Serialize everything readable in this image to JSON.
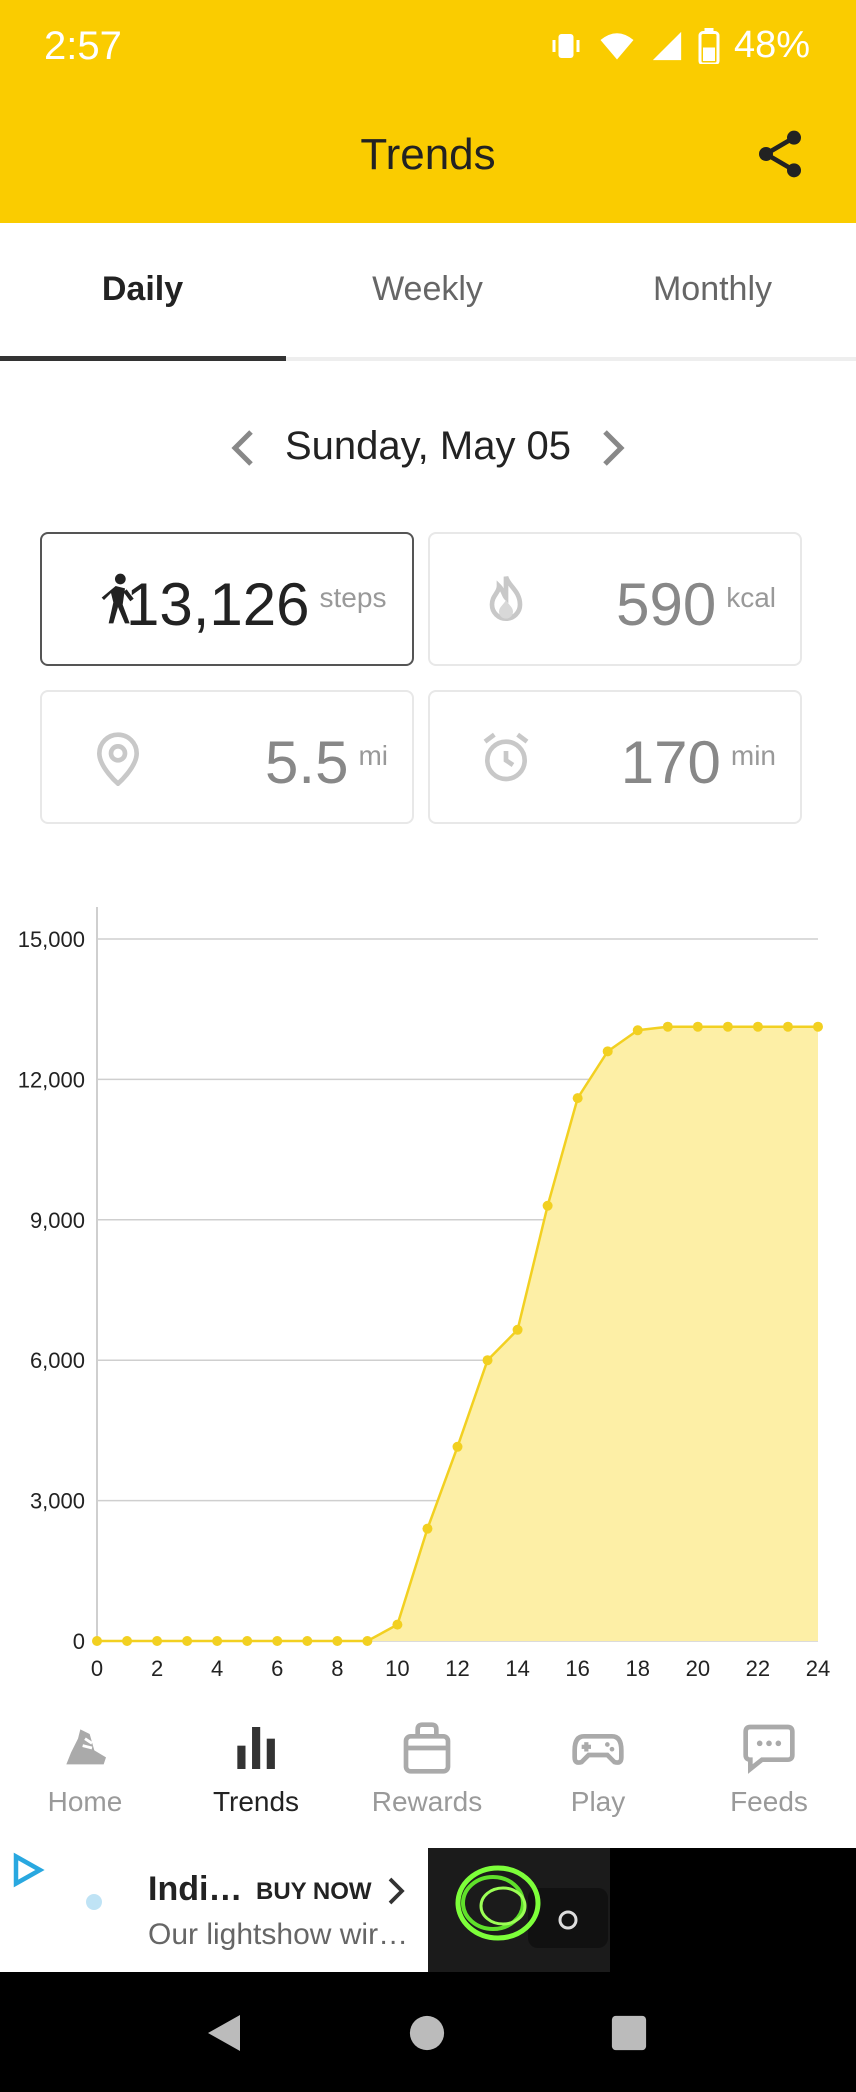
{
  "status_bar": {
    "time": "2:57",
    "battery": "48%"
  },
  "header": {
    "title": "Trends"
  },
  "tabs": [
    {
      "label": "Daily",
      "active": true
    },
    {
      "label": "Weekly",
      "active": false
    },
    {
      "label": "Monthly",
      "active": false
    }
  ],
  "date_nav": {
    "label": "Sunday, May 05"
  },
  "stats": {
    "steps": {
      "value": "13,126",
      "unit": "steps"
    },
    "calories": {
      "value": "590",
      "unit": "kcal"
    },
    "distance": {
      "value": "5.5",
      "unit": "mi"
    },
    "active_time": {
      "value": "170",
      "unit": "min"
    }
  },
  "chart_data": {
    "type": "area",
    "x": [
      0,
      1,
      2,
      3,
      4,
      5,
      6,
      7,
      8,
      9,
      10,
      11,
      12,
      13,
      14,
      15,
      16,
      17,
      18,
      19,
      20,
      21,
      22,
      23,
      24
    ],
    "series": [
      {
        "values": [
          0,
          0,
          0,
          0,
          0,
          0,
          0,
          0,
          0,
          0,
          350,
          2400,
          4150,
          6000,
          6650,
          9300,
          11600,
          12600,
          13050,
          13126,
          13126,
          13126,
          13126,
          13126,
          13126
        ]
      }
    ],
    "y_ticks": [
      "0",
      "3,000",
      "6,000",
      "9,000",
      "12,000",
      "15,000"
    ],
    "x_ticks": [
      "0",
      "2",
      "4",
      "6",
      "8",
      "10",
      "12",
      "14",
      "16",
      "18",
      "20",
      "22",
      "24"
    ],
    "xlim": [
      0,
      24
    ],
    "ylim": [
      0,
      15000
    ],
    "grid": true,
    "colors": {
      "line": "#F2D021",
      "fill": "#FDEFA6"
    }
  },
  "bottom_nav": [
    {
      "label": "Home",
      "icon": "shoe-icon",
      "active": false
    },
    {
      "label": "Trends",
      "icon": "bar-chart-icon",
      "active": true
    },
    {
      "label": "Rewards",
      "icon": "bag-icon",
      "active": false
    },
    {
      "label": "Play",
      "icon": "gamepad-icon",
      "active": false
    },
    {
      "label": "Feeds",
      "icon": "chat-icon",
      "active": false
    }
  ],
  "ad": {
    "title": "Indi…",
    "cta": "BUY NOW",
    "description": "Our lightshow wir…"
  },
  "colors": {
    "brand": "#FACC00",
    "chart_line": "#F2D021",
    "chart_fill": "#FDEFA6"
  }
}
